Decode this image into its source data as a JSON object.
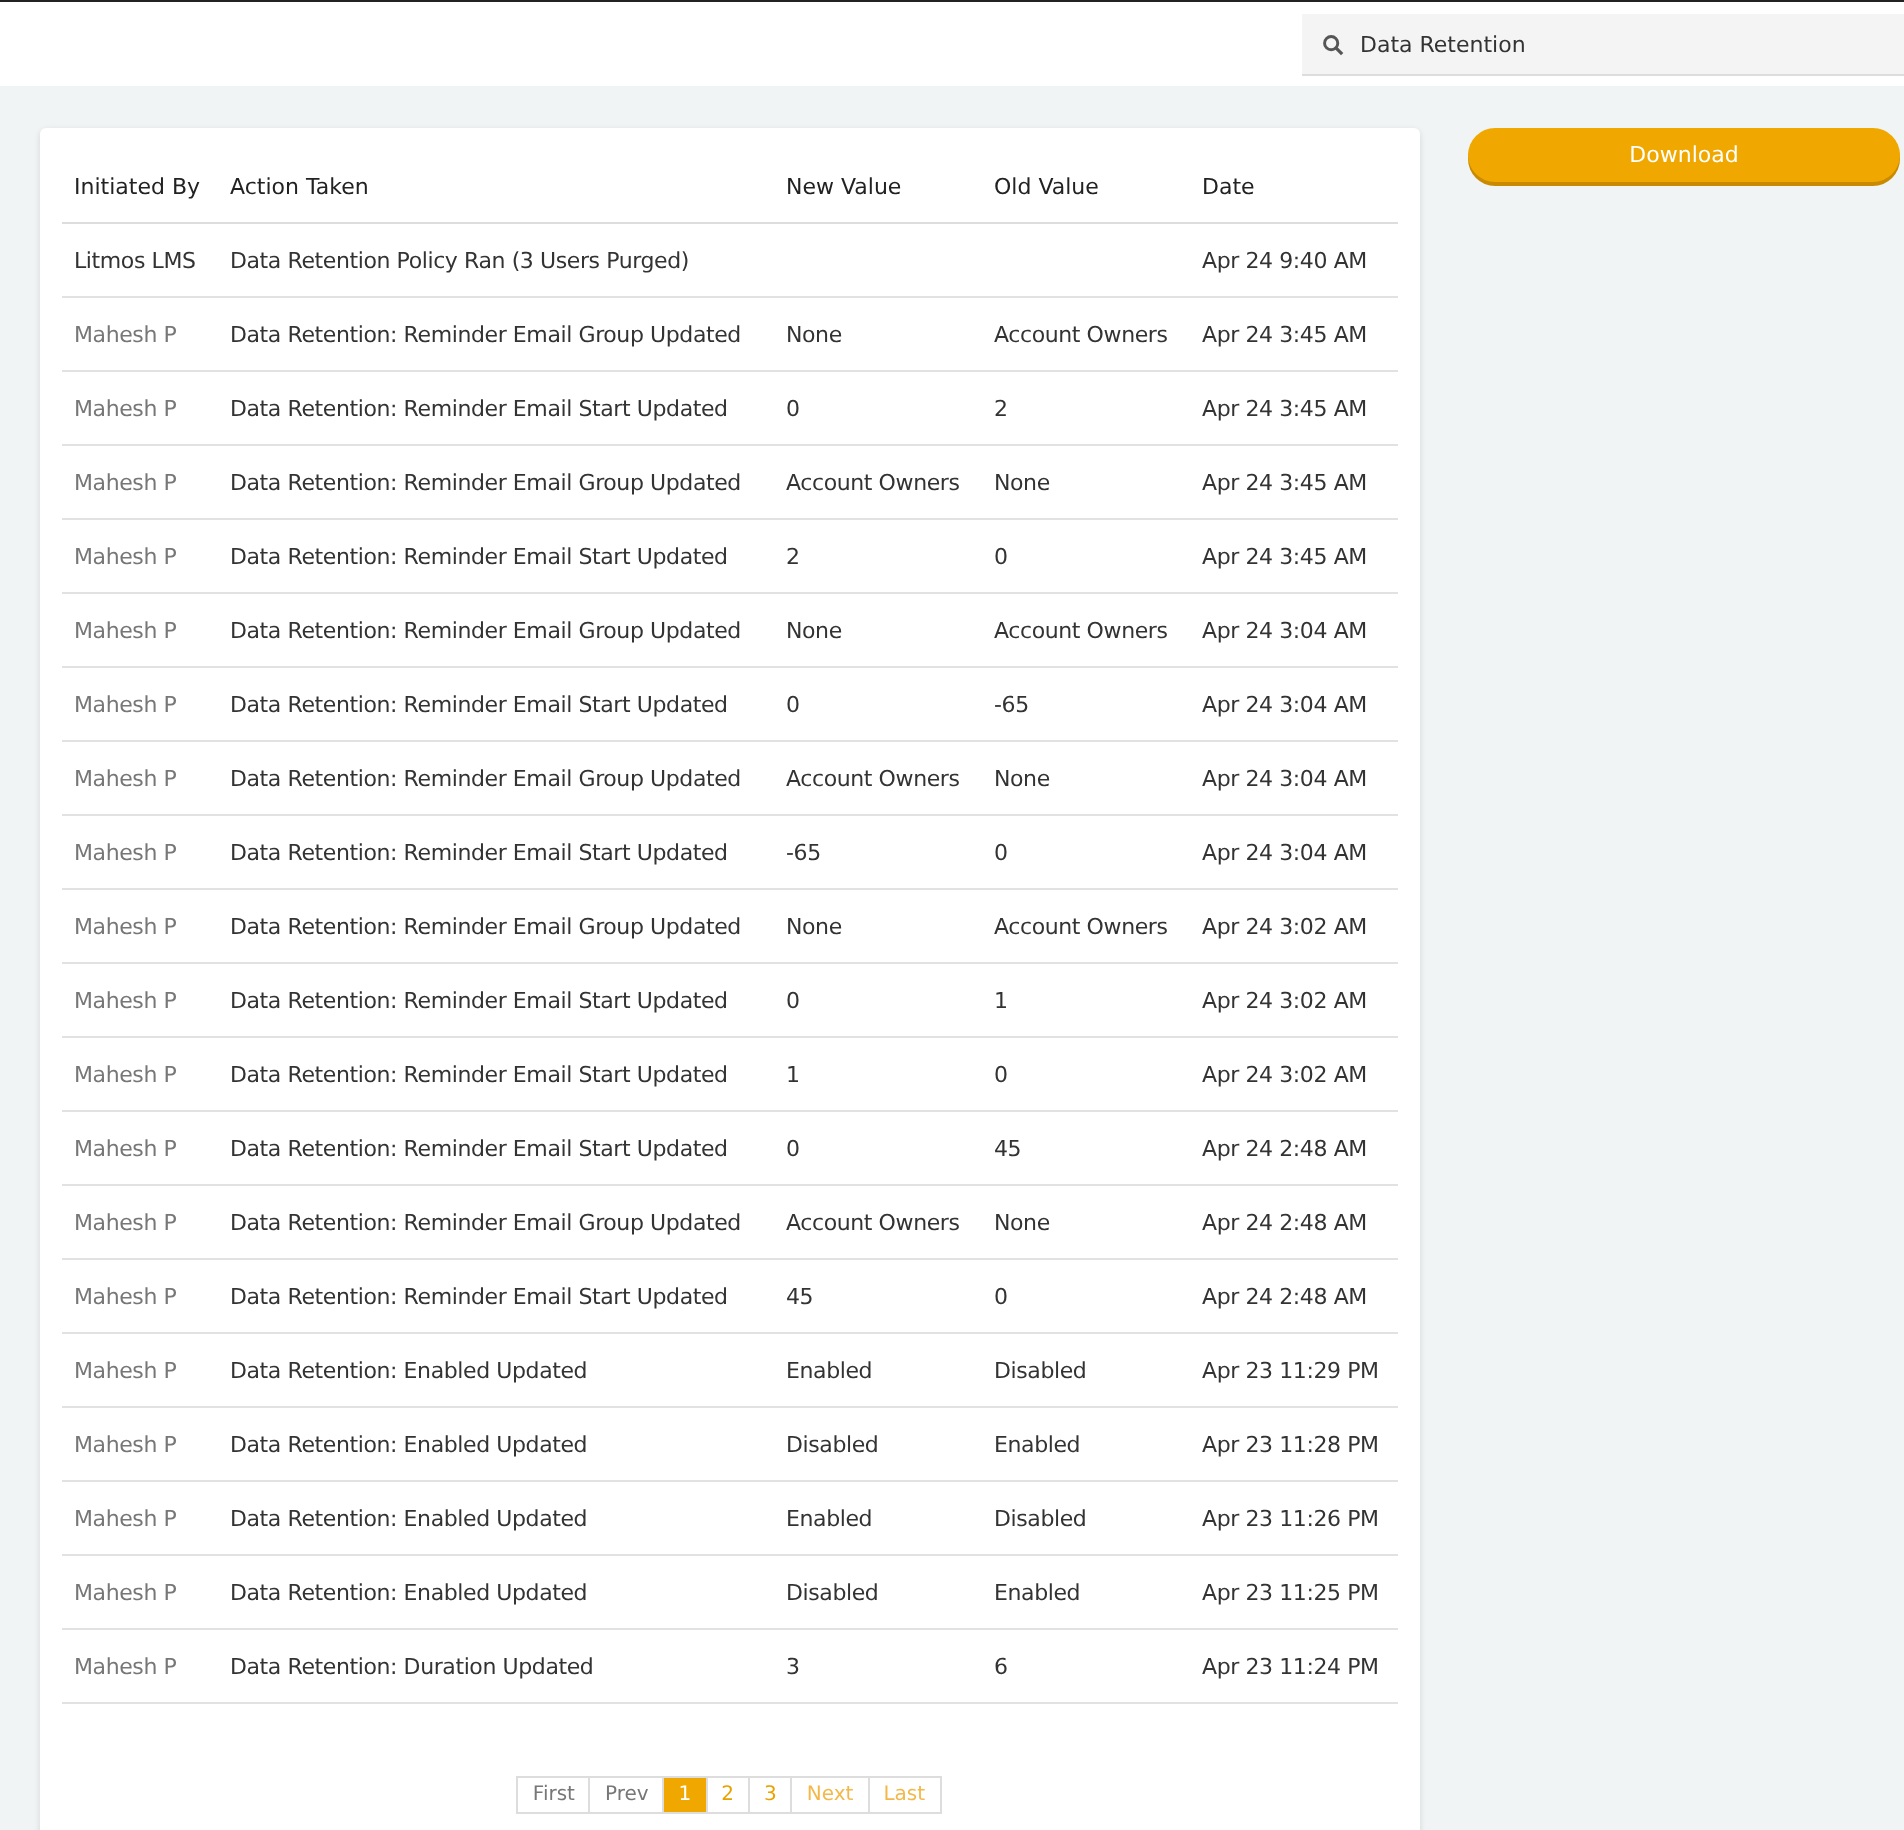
{
  "search": {
    "value": "Data Retention"
  },
  "download_button": "Download",
  "table": {
    "columns": [
      "Initiated By",
      "Action Taken",
      "New Value",
      "Old Value",
      "Date"
    ],
    "rows": [
      {
        "initiated_by": "Litmos LMS",
        "kind": "system",
        "action": "Data Retention Policy Ran (3 Users Purged)",
        "new_value": "",
        "old_value": "",
        "date": "Apr 24 9:40 AM"
      },
      {
        "initiated_by": "Mahesh P",
        "kind": "user",
        "action": "Data Retention: Reminder Email Group Updated",
        "new_value": "None",
        "old_value": "Account Owners",
        "date": "Apr 24 3:45 AM"
      },
      {
        "initiated_by": "Mahesh P",
        "kind": "user",
        "action": "Data Retention: Reminder Email Start Updated",
        "new_value": "0",
        "old_value": "2",
        "date": "Apr 24 3:45 AM"
      },
      {
        "initiated_by": "Mahesh P",
        "kind": "user",
        "action": "Data Retention: Reminder Email Group Updated",
        "new_value": "Account Owners",
        "old_value": "None",
        "date": "Apr 24 3:45 AM"
      },
      {
        "initiated_by": "Mahesh P",
        "kind": "user",
        "action": "Data Retention: Reminder Email Start Updated",
        "new_value": "2",
        "old_value": "0",
        "date": "Apr 24 3:45 AM"
      },
      {
        "initiated_by": "Mahesh P",
        "kind": "user",
        "action": "Data Retention: Reminder Email Group Updated",
        "new_value": "None",
        "old_value": "Account Owners",
        "date": "Apr 24 3:04 AM"
      },
      {
        "initiated_by": "Mahesh P",
        "kind": "user",
        "action": "Data Retention: Reminder Email Start Updated",
        "new_value": "0",
        "old_value": "-65",
        "date": "Apr 24 3:04 AM"
      },
      {
        "initiated_by": "Mahesh P",
        "kind": "user",
        "action": "Data Retention: Reminder Email Group Updated",
        "new_value": "Account Owners",
        "old_value": "None",
        "date": "Apr 24 3:04 AM"
      },
      {
        "initiated_by": "Mahesh P",
        "kind": "user",
        "action": "Data Retention: Reminder Email Start Updated",
        "new_value": "-65",
        "old_value": "0",
        "date": "Apr 24 3:04 AM"
      },
      {
        "initiated_by": "Mahesh P",
        "kind": "user",
        "action": "Data Retention: Reminder Email Group Updated",
        "new_value": "None",
        "old_value": "Account Owners",
        "date": "Apr 24 3:02 AM"
      },
      {
        "initiated_by": "Mahesh P",
        "kind": "user",
        "action": "Data Retention: Reminder Email Start Updated",
        "new_value": "0",
        "old_value": "1",
        "date": "Apr 24 3:02 AM"
      },
      {
        "initiated_by": "Mahesh P",
        "kind": "user",
        "action": "Data Retention: Reminder Email Start Updated",
        "new_value": "1",
        "old_value": "0",
        "date": "Apr 24 3:02 AM"
      },
      {
        "initiated_by": "Mahesh P",
        "kind": "user",
        "action": "Data Retention: Reminder Email Start Updated",
        "new_value": "0",
        "old_value": "45",
        "date": "Apr 24 2:48 AM"
      },
      {
        "initiated_by": "Mahesh P",
        "kind": "user",
        "action": "Data Retention: Reminder Email Group Updated",
        "new_value": "Account Owners",
        "old_value": "None",
        "date": "Apr 24 2:48 AM"
      },
      {
        "initiated_by": "Mahesh P",
        "kind": "user",
        "action": "Data Retention: Reminder Email Start Updated",
        "new_value": "45",
        "old_value": "0",
        "date": "Apr 24 2:48 AM"
      },
      {
        "initiated_by": "Mahesh P",
        "kind": "user",
        "action": "Data Retention: Enabled Updated",
        "new_value": "Enabled",
        "old_value": "Disabled",
        "date": "Apr 23 11:29 PM"
      },
      {
        "initiated_by": "Mahesh P",
        "kind": "user",
        "action": "Data Retention: Enabled Updated",
        "new_value": "Disabled",
        "old_value": "Enabled",
        "date": "Apr 23 11:28 PM"
      },
      {
        "initiated_by": "Mahesh P",
        "kind": "user",
        "action": "Data Retention: Enabled Updated",
        "new_value": "Enabled",
        "old_value": "Disabled",
        "date": "Apr 23 11:26 PM"
      },
      {
        "initiated_by": "Mahesh P",
        "kind": "user",
        "action": "Data Retention: Enabled Updated",
        "new_value": "Disabled",
        "old_value": "Enabled",
        "date": "Apr 23 11:25 PM"
      },
      {
        "initiated_by": "Mahesh P",
        "kind": "user",
        "action": "Data Retention: Duration Updated",
        "new_value": "3",
        "old_value": "6",
        "date": "Apr 23 11:24 PM"
      }
    ]
  },
  "pagination": [
    {
      "label": "First",
      "kind": "nav",
      "disabled": true,
      "selected": false
    },
    {
      "label": "Prev",
      "kind": "nav",
      "disabled": true,
      "selected": false
    },
    {
      "label": "1",
      "kind": "page",
      "disabled": false,
      "selected": true
    },
    {
      "label": "2",
      "kind": "page",
      "disabled": false,
      "selected": false
    },
    {
      "label": "3",
      "kind": "page",
      "disabled": false,
      "selected": false
    },
    {
      "label": "Next",
      "kind": "nav",
      "disabled": false,
      "selected": false
    },
    {
      "label": "Last",
      "kind": "nav",
      "disabled": false,
      "selected": false
    }
  ]
}
